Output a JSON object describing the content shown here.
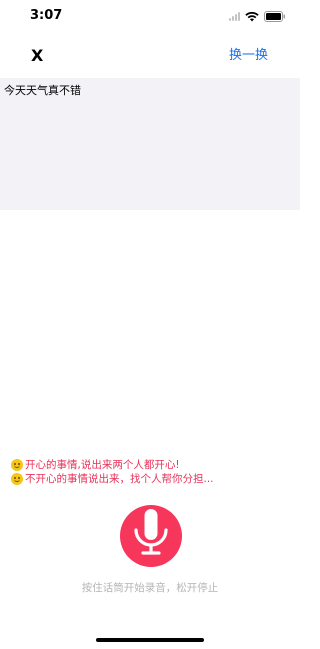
{
  "status_bar": {
    "time": "3:07",
    "icons": [
      "signal-icon",
      "wifi-icon",
      "battery-icon"
    ]
  },
  "nav": {
    "close_label": "X",
    "switch_label": "换一换"
  },
  "text_panel": {
    "content": "今天天气真不错"
  },
  "tips": [
    {
      "icon": "smile-emoji-icon",
      "text": "开心的事情,说出来两个人都开心!"
    },
    {
      "icon": "cry-laugh-emoji-icon",
      "text": "不开心的事情说出来，找个人帮你分担..."
    }
  ],
  "mic": {
    "icon": "microphone-icon"
  },
  "hint": "按住话筒开始录音，松开停止",
  "colors": {
    "accent": "#1a73e8",
    "tip_text": "#e8335a",
    "mic_bg": "#f7365b",
    "panel_bg": "#f2f2f7",
    "hint_text": "#b5b5b5"
  }
}
